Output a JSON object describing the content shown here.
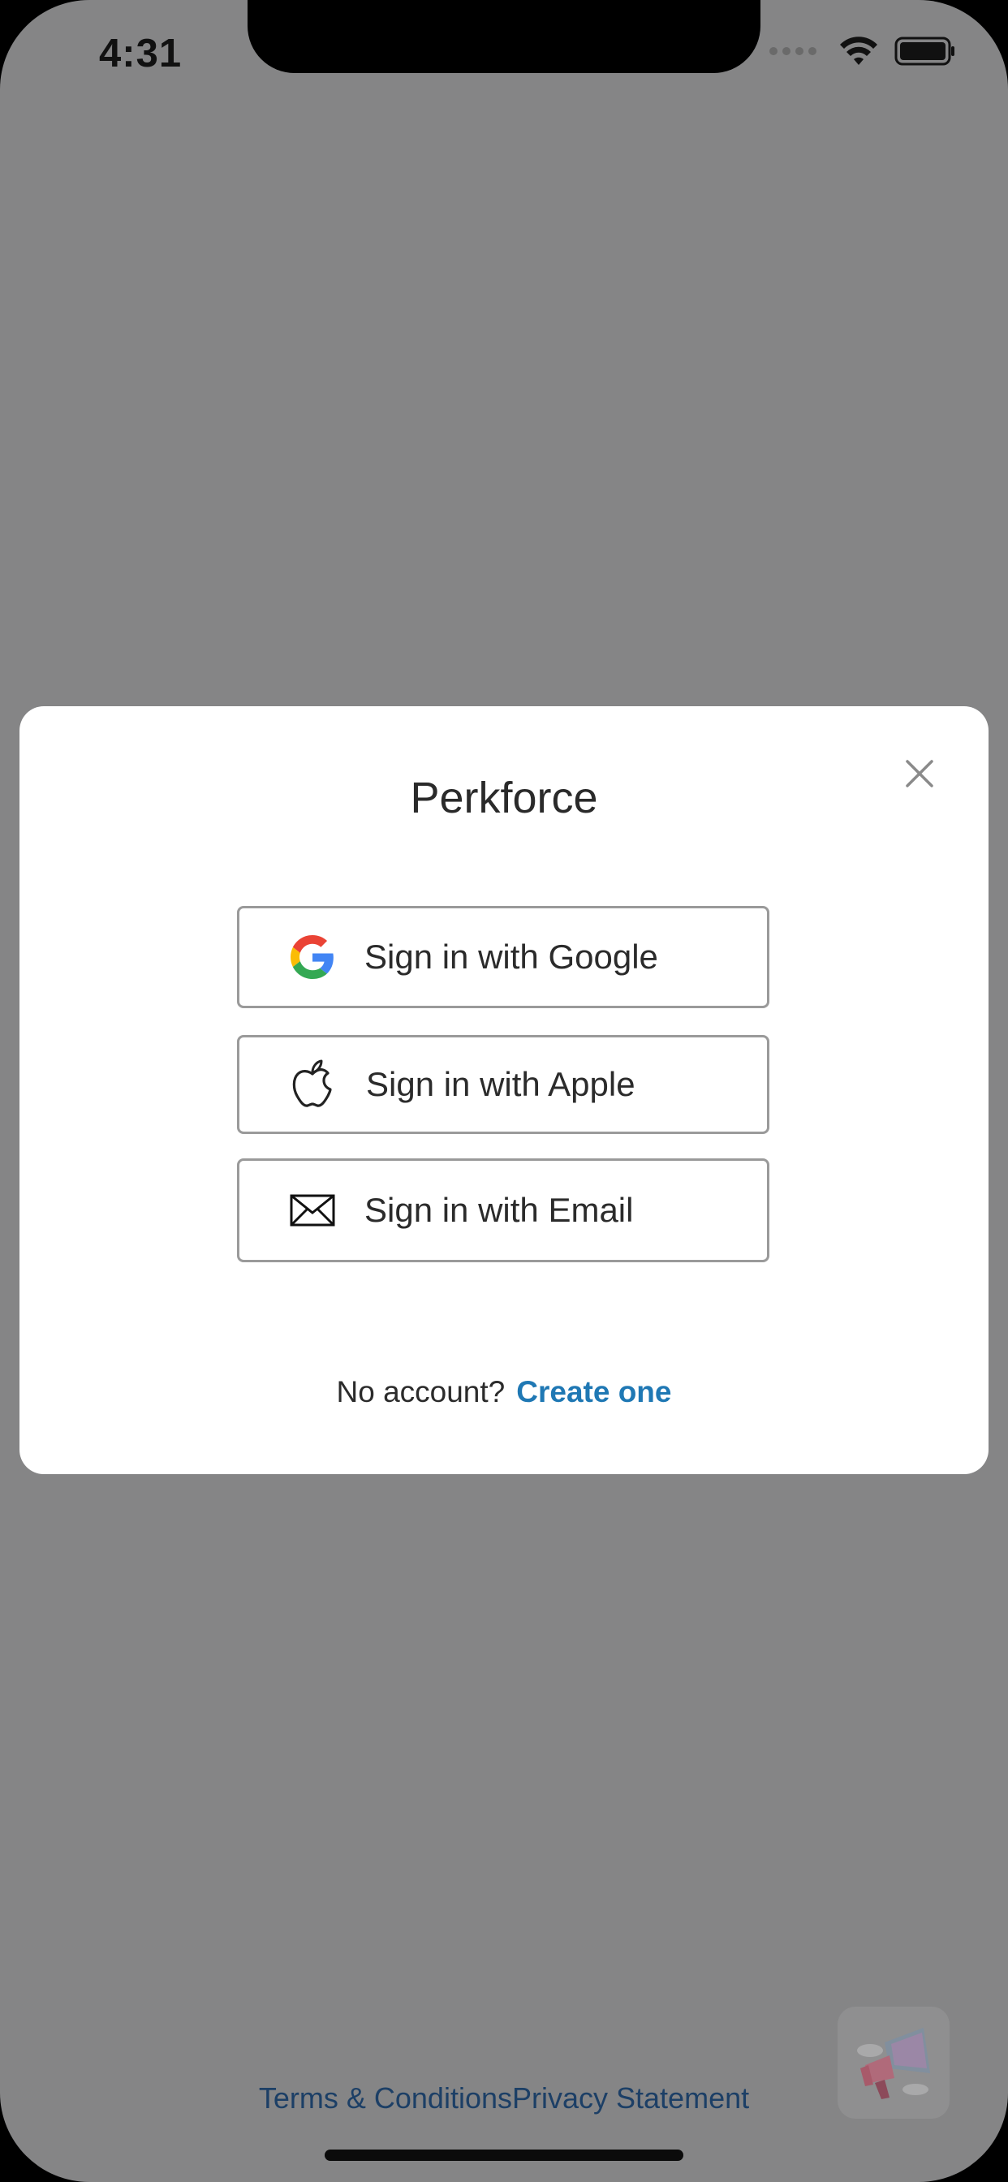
{
  "status_bar": {
    "time": "4:31",
    "icons": [
      "signal-icon",
      "wifi-icon",
      "battery-icon"
    ]
  },
  "modal": {
    "title": "Perkforce",
    "close_icon": "close-icon",
    "buttons": [
      {
        "label": "Sign in with Google",
        "icon": "google-icon"
      },
      {
        "label": "Sign in with Apple",
        "icon": "apple-icon"
      },
      {
        "label": "Sign in with Email",
        "icon": "envelope-icon"
      }
    ],
    "no_account_text": "No account?",
    "create_account_link": "Create one"
  },
  "footer": {
    "terms_link": "Terms & Conditions",
    "privacy_link": "Privacy Statement"
  },
  "fab": {
    "icon": "megaphone-icon"
  },
  "colors": {
    "overlay": "#858586",
    "link": "#1f78b4",
    "footer_link": "#1c3f66",
    "button_border": "#9a9a9a"
  }
}
